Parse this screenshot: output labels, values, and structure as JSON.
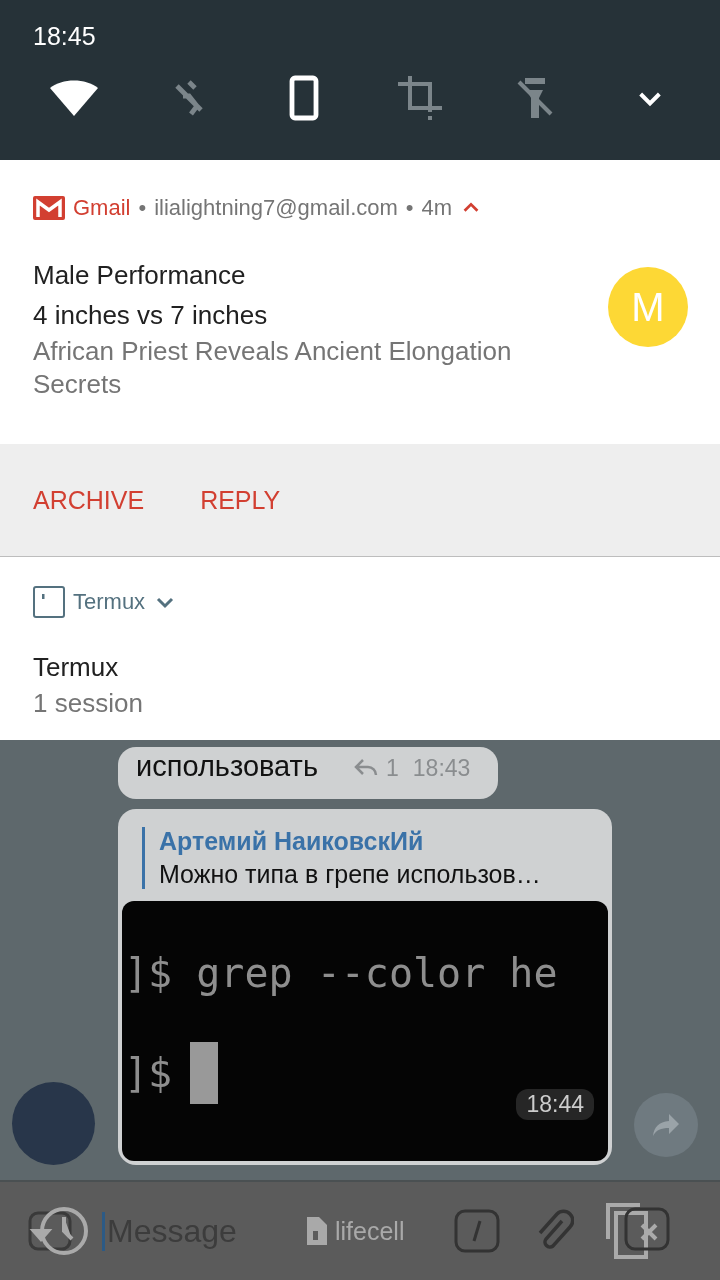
{
  "status_bar": {
    "time": "18:45"
  },
  "quick_settings": [
    {
      "kind": "wifi",
      "on": true
    },
    {
      "kind": "bluetooth",
      "on": false
    },
    {
      "kind": "rotation",
      "on": true
    },
    {
      "kind": "crop",
      "on": false
    },
    {
      "kind": "flashlight",
      "on": false
    }
  ],
  "notifications": [
    {
      "kind": "gmail",
      "app": "Gmail",
      "separator": "•",
      "account": "ilialightning7@gmail.com",
      "time": "4m",
      "expanded": true,
      "title": "Male Performance",
      "subject": "4 inches vs 7 inches",
      "body": "African Priest Reveals Ancient Elongation Secrets",
      "avatar_letter": "M",
      "actions": [
        "ARCHIVE",
        "REPLY"
      ]
    },
    {
      "kind": "termux",
      "app": "Termux",
      "expanded": false,
      "title": "Termux",
      "body": "1 session"
    }
  ],
  "chat": {
    "messages": [
      {
        "kind": "text",
        "text": "использовать",
        "replies": "1",
        "time": "18:43"
      },
      {
        "kind": "screenshot",
        "reply_author": "Артемий НаиковскИй",
        "reply_text": "Можно типа в грепе использов…",
        "terminal_lines": [
          "]$ grep --color he",
          "]$"
        ],
        "time": "18:44"
      }
    ]
  },
  "input": {
    "placeholder": "Message",
    "sim": "lifecell"
  }
}
